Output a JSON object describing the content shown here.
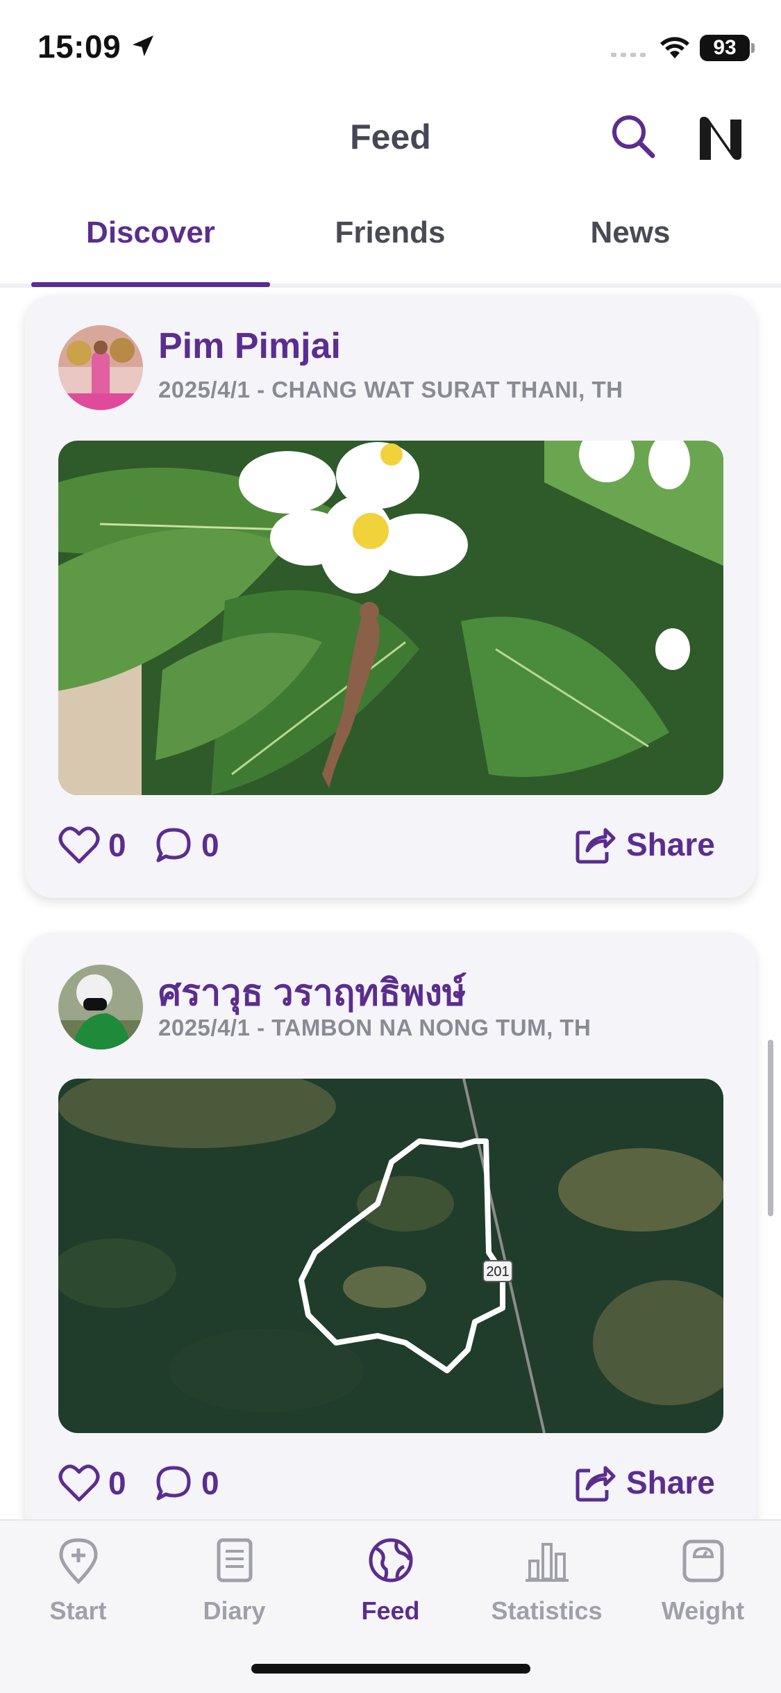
{
  "status_bar": {
    "time": "15:09",
    "battery": "93"
  },
  "header": {
    "title": "Feed",
    "search_icon": "search-icon",
    "logo_icon": "n-logo-icon"
  },
  "tabs": [
    {
      "label": "Discover",
      "active": true
    },
    {
      "label": "Friends",
      "active": false
    },
    {
      "label": "News",
      "active": false
    }
  ],
  "posts": [
    {
      "author": "Pim Pimjai",
      "meta": "2025/4/1 - CHANG WAT SURAT THANI, TH",
      "photo": "frangipani-flowers-lizard",
      "likes": "0",
      "comments": "0",
      "share_label": "Share"
    },
    {
      "author": "ศราวุธ วราฤทธิพงษ์",
      "meta": "2025/4/1 - TAMBON NA NONG TUM, TH",
      "photo": "satellite-map-route",
      "map_road_label": "201",
      "likes": "0",
      "comments": "0",
      "share_label": "Share"
    }
  ],
  "bottom_nav": [
    {
      "label": "Start",
      "icon": "map-pin-plus-icon",
      "active": false
    },
    {
      "label": "Diary",
      "icon": "diary-icon",
      "active": false
    },
    {
      "label": "Feed",
      "icon": "globe-icon",
      "active": true
    },
    {
      "label": "Statistics",
      "icon": "bar-chart-icon",
      "active": false
    },
    {
      "label": "Weight",
      "icon": "scale-icon",
      "active": false
    }
  ],
  "colors": {
    "accent": "#5b2d8e",
    "inactive": "#a0a0a8",
    "card_bg": "#f4f4f9"
  }
}
